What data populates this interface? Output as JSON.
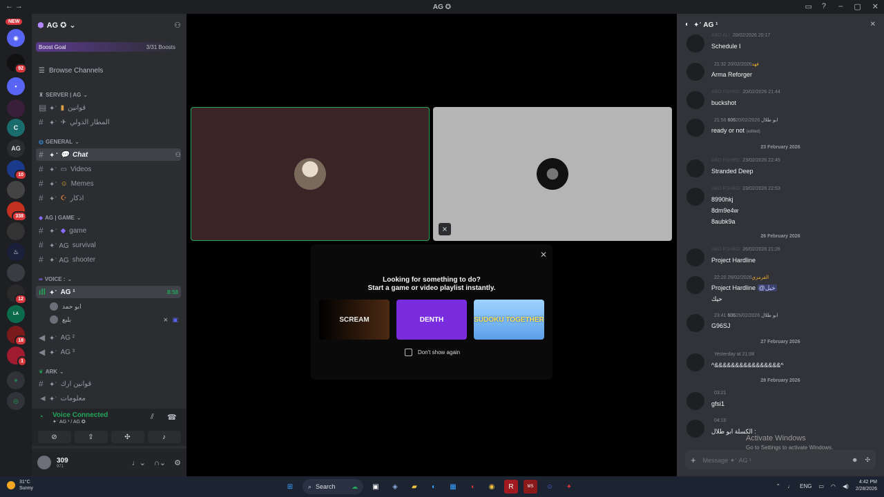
{
  "window": {
    "title": "AG ✪"
  },
  "guilds": {
    "new_badge": "NEW",
    "badges": [
      "92",
      "10",
      "338",
      "12",
      "18",
      "1"
    ]
  },
  "server": {
    "name": "AG ✪",
    "boost_goal": "Boost Goal",
    "boost_count": "3/31 Boosts",
    "browse": "Browse Channels",
    "categories": [
      {
        "label": "SERVER | AG"
      },
      {
        "label": "General"
      },
      {
        "label": "AG | game"
      },
      {
        "label": "Voice :"
      },
      {
        "label": "Ark"
      }
    ],
    "channels": [
      {
        "prefix": "✦ॱ",
        "label": "قوانين"
      },
      {
        "prefix": "✦ॱ",
        "label": "المطار الدولي"
      },
      {
        "prefix": "✦ॱ",
        "label": "Chat"
      },
      {
        "prefix": "✦ॱ",
        "label": "Videos"
      },
      {
        "prefix": "✦ॱ",
        "label": "Memes"
      },
      {
        "prefix": "✦ॱ",
        "label": "اذكار"
      },
      {
        "prefix": "✦ॱ",
        "label": "game"
      },
      {
        "prefix": "✦ॱ AG",
        "label": "survival"
      },
      {
        "prefix": "✦ॱ AG",
        "label": "shooter"
      },
      {
        "prefix": "✦ॱ",
        "label": "AG ¹"
      },
      {
        "prefix": "✦ॱ",
        "label": "AG ²"
      },
      {
        "prefix": "✦ॱ",
        "label": "AG ³"
      },
      {
        "prefix": "✦ॱ",
        "label": "قوانين ارك"
      },
      {
        "prefix": "✦ॱ",
        "label": "معلومات"
      }
    ],
    "voice_time": "8:58",
    "voice_users": [
      "ابو حمد",
      "بلبع"
    ]
  },
  "voice_panel": {
    "status": "Voice Connected",
    "channel": "✦ॱ AG ¹ / AG ✪"
  },
  "user": {
    "name": "309",
    "status": "971"
  },
  "popup": {
    "line1": "Looking for something to do?",
    "line2": "Start a game or video playlist instantly.",
    "cards": [
      "SCREAM",
      "DENTH",
      "SUDOKU TOGETHER"
    ],
    "dont_show": "Don't show again"
  },
  "chat": {
    "title": "✦ॱ AG ¹",
    "messages": [
      {
        "name": "ABO ALI",
        "date": "20/02/2026 20:17",
        "lines": [
          "Schedule I"
        ]
      },
      {
        "name": "فهد",
        "date": "20/02/2026 21:32",
        "lines": [
          "Arma Reforger"
        ]
      },
      {
        "name": "ABO RSHED",
        "date": "20/02/2026 21:44",
        "lines": [
          "buckshot"
        ]
      },
      {
        "name": "ابو طلال 606",
        "date": "20/02/2026 21:56",
        "lines": [
          "ready or not"
        ],
        "edited": "(edited)"
      },
      {
        "name": "ABO RSHED",
        "date": "23/02/2026 22:45",
        "lines": [
          "Stranded Deep"
        ]
      },
      {
        "name": "ABO RSHED",
        "date": "23/02/2026 22:53",
        "lines": [
          "8990hkj",
          "8dm9e4w",
          "8aubk9a"
        ]
      },
      {
        "name": "ABO RSHED",
        "date": "26/02/2026 21:26",
        "lines": [
          "Project Hardline"
        ]
      },
      {
        "name": "القرمزي",
        "date": "26/02/2026 22:20",
        "lines": [
          "Project Hardline",
          "حيك"
        ],
        "mention": "@خيل"
      },
      {
        "name": "ابو طلال 606",
        "date": "26/02/2026 23:41",
        "lines": [
          "G96SJ"
        ]
      },
      {
        "name": "",
        "date": "Yesterday at 21:08",
        "lines": [
          "^&&&&&&&&&&&&&&&&^"
        ]
      },
      {
        "name": "",
        "date": "03:21",
        "lines": [
          "gfsi1"
        ]
      },
      {
        "name": "",
        "date": "04:10",
        "lines": [
          "الكسلة ابو طلال :"
        ]
      }
    ],
    "separators": [
      "23 February 2026",
      "26 February 2026",
      "27 February 2026",
      "28 February 2026"
    ],
    "input_placeholder": "Message ✦ॱ AG ¹"
  },
  "activate": {
    "line1": "Activate Windows",
    "line2": "Go to Settings to activate Windows."
  },
  "taskbar": {
    "temp": "31°C",
    "cond": "Sunny",
    "search": "Search",
    "lang": "ENG",
    "time": "4:42 PM",
    "date": "2/28/2026"
  },
  "colors": {
    "accent": "#5865f2",
    "online": "#23a55a",
    "danger": "#da373c"
  }
}
